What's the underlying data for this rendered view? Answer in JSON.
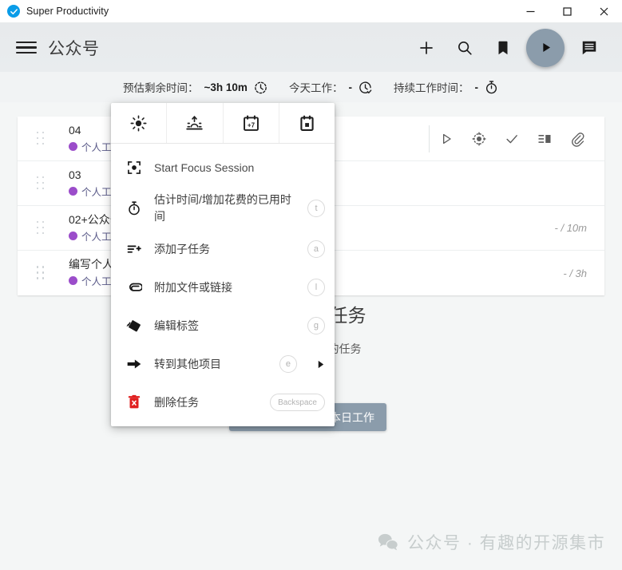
{
  "window": {
    "title": "Super Productivity",
    "logo_icon": "check-circle-icon",
    "minimize_label": "—",
    "maximize_label": "□",
    "close_label": "✕"
  },
  "header": {
    "menu_icon": "hamburger-menu-icon",
    "project_title": "公众号",
    "actions": [
      {
        "icon": "add-icon"
      },
      {
        "icon": "search-icon"
      },
      {
        "icon": "bookmark-icon"
      },
      {
        "icon": "play-icon"
      },
      {
        "icon": "notes-icon"
      }
    ]
  },
  "stats": [
    {
      "label": "预估剩余时间：",
      "value": "~3h 10m",
      "icon": "clock-remaining-icon"
    },
    {
      "label": "今天工作：",
      "value": "-",
      "icon": "clock-check-icon"
    },
    {
      "label": "持续工作时间：",
      "value": "-",
      "icon": "timer-icon"
    }
  ],
  "tasks": [
    {
      "title": "04",
      "tag": "个人工具",
      "tag_color": "#9b4dca",
      "time": "",
      "actions": [
        {
          "icon": "play-outline-icon"
        },
        {
          "icon": "sun-icon"
        },
        {
          "icon": "check-icon"
        },
        {
          "icon": "subtask-list-icon"
        },
        {
          "icon": "attachment-icon"
        }
      ]
    },
    {
      "title": "03",
      "tag": "个人工具",
      "tag_color": "#9b4dca",
      "time": "",
      "actions": []
    },
    {
      "title": "02+公众号",
      "tag": "个人工具",
      "tag_color": "#9b4dca",
      "time": "- / 10m",
      "actions": []
    },
    {
      "title": "编写个人作品",
      "tag": "个人工具",
      "tag_color": "#9b4dca",
      "time": "- / 3h",
      "actions": []
    }
  ],
  "empty_zone": {
    "title": "没有更多任务",
    "subtitle": "没有更多待办的任务"
  },
  "finish_button": {
    "label": "完成当前项目本日工作",
    "icon": "double-check-icon",
    "background": "#8b9cab"
  },
  "watermark": {
    "icon": "wechat-icon",
    "text": "公众号 · 有趣的开源集市",
    "color": "#c7cdcd"
  },
  "context_menu": {
    "tabs": [
      {
        "icon": "sun-icon",
        "name": "today"
      },
      {
        "icon": "sunrise-icon",
        "name": "tomorrow"
      },
      {
        "icon": "calendar-plus7-icon",
        "name": "next-week"
      },
      {
        "icon": "calendar-day-icon",
        "name": "pick-date"
      }
    ],
    "items": [
      {
        "icon": "focus-session-icon",
        "label": "Start Focus Session",
        "shortcut": "",
        "submenu": false,
        "lang": "en"
      },
      {
        "icon": "timer-icon",
        "label": "估计时间/增加花费的已用时间",
        "shortcut": "t",
        "submenu": false
      },
      {
        "icon": "add-subtask-icon",
        "label": "添加子任务",
        "shortcut": "a",
        "submenu": false
      },
      {
        "icon": "attachment-icon",
        "label": "附加文件或链接",
        "shortcut": "l",
        "submenu": false
      },
      {
        "icon": "tag-icon",
        "label": "编辑标签",
        "shortcut": "g",
        "submenu": false
      },
      {
        "icon": "arrow-right-icon",
        "label": "转到其他项目",
        "shortcut": "e",
        "submenu": true
      },
      {
        "icon": "delete-icon",
        "label": "删除任务",
        "shortcut": "Backspace",
        "submenu": false,
        "danger": true
      }
    ]
  }
}
